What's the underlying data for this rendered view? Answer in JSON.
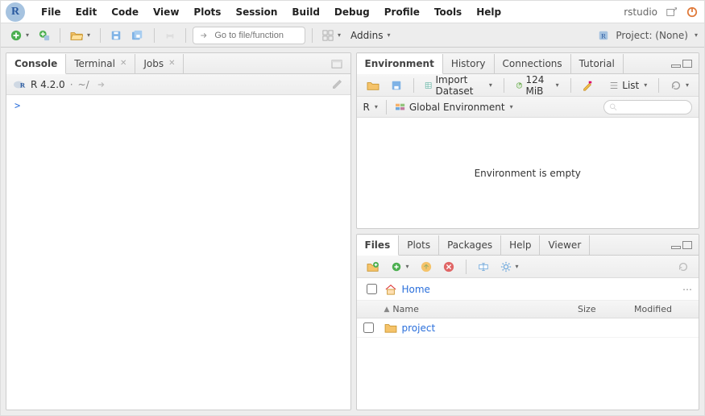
{
  "menubar": {
    "items": [
      "File",
      "Edit",
      "Code",
      "View",
      "Plots",
      "Session",
      "Build",
      "Debug",
      "Profile",
      "Tools",
      "Help"
    ],
    "brand": "rstudio"
  },
  "toolbar": {
    "goto_placeholder": "Go to file/function",
    "addins_label": "Addins",
    "project_label": "Project: (None)"
  },
  "left_pane": {
    "tabs": [
      "Console",
      "Terminal",
      "Jobs"
    ],
    "active_tab": 0,
    "console": {
      "version": "R 4.2.0",
      "cwd": "~/",
      "prompt": ">"
    }
  },
  "top_right_pane": {
    "tabs": [
      "Environment",
      "History",
      "Connections",
      "Tutorial"
    ],
    "active_tab": 0,
    "toolbar": {
      "import_label": "Import Dataset",
      "memory": "124 MiB",
      "view_label": "List"
    },
    "scope": {
      "language": "R",
      "environment": "Global Environment"
    },
    "empty_message": "Environment is empty"
  },
  "bottom_right_pane": {
    "tabs": [
      "Files",
      "Plots",
      "Packages",
      "Help",
      "Viewer"
    ],
    "active_tab": 0,
    "breadcrumb": {
      "home_label": "Home"
    },
    "columns": {
      "name": "Name",
      "size": "Size",
      "modified": "Modified"
    },
    "rows": [
      {
        "type": "folder",
        "name": "project",
        "size": "",
        "modified": ""
      }
    ]
  }
}
